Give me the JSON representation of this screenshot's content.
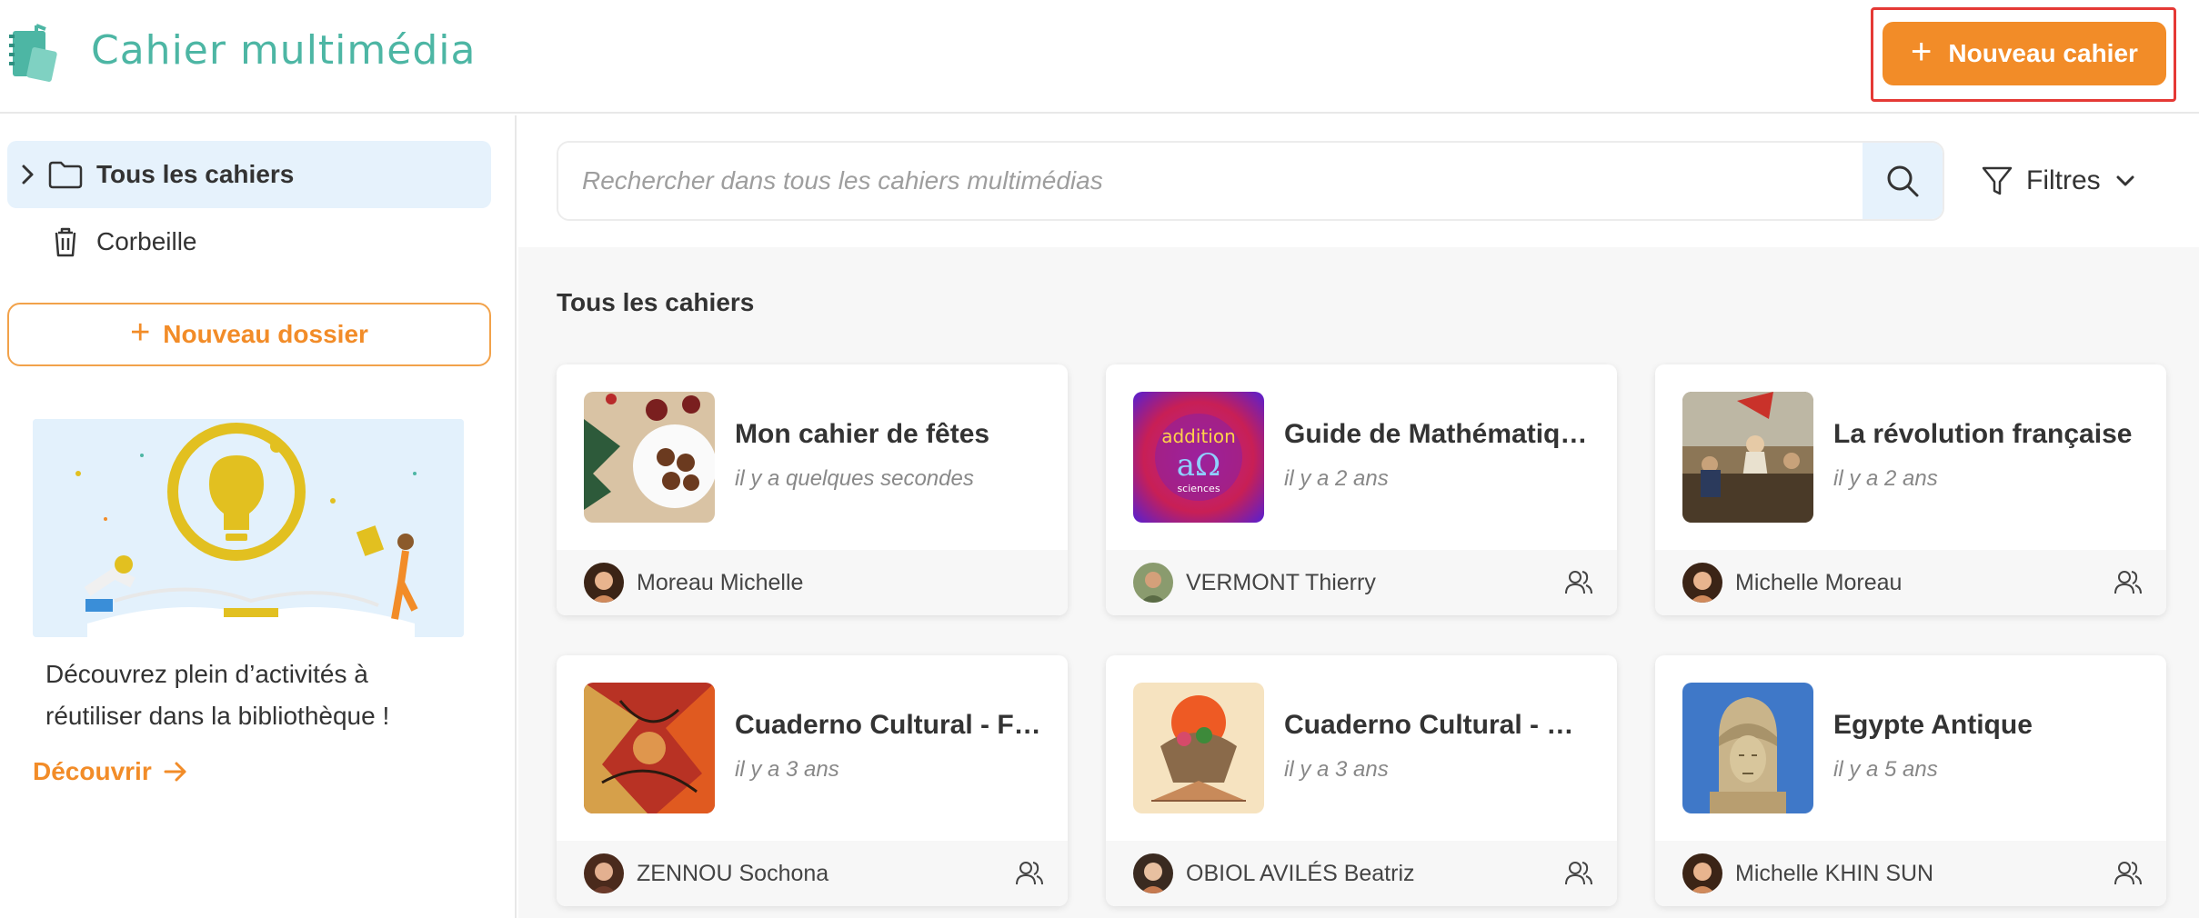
{
  "app": {
    "title": "Cahier multimédia",
    "new_cahier_label": "Nouveau cahier",
    "accent_color": "#f28c28",
    "brand_color": "#4db6a4"
  },
  "sidebar": {
    "items": [
      {
        "label": "Tous les cahiers",
        "icon": "folder-icon",
        "active": true
      },
      {
        "label": "Corbeille",
        "icon": "trash-icon",
        "active": false
      }
    ],
    "new_folder_label": "Nouveau dossier",
    "promo": {
      "text": "Découvrez plein d’activités à réutiliser dans la bibliothèque !",
      "link_label": "Découvrir"
    }
  },
  "search": {
    "placeholder": "Rechercher dans tous les cahiers multimédias"
  },
  "filters": {
    "label": "Filtres"
  },
  "main": {
    "section_title": "Tous les cahiers",
    "cards": [
      {
        "title": "Mon cahier de fêtes",
        "date": "il y a quelques secondes",
        "author": "Moreau Michelle",
        "shared": false
      },
      {
        "title": "Guide de Mathématique…",
        "date": "il y a 2 ans",
        "author": "VERMONT Thierry",
        "shared": true
      },
      {
        "title": "La révolution française",
        "date": "il y a 2 ans",
        "author": "Michelle Moreau",
        "shared": true
      },
      {
        "title": "Cuaderno Cultural - Fra…",
        "date": "il y a 3 ans",
        "author": "ZENNOU Sochona",
        "shared": true
      },
      {
        "title": "Cuaderno Cultural - Mex…",
        "date": "il y a 3 ans",
        "author": "OBIOL AVILÉS Beatriz",
        "shared": true
      },
      {
        "title": "Egypte Antique",
        "date": "il y a 5 ans",
        "author": "Michelle KHIN SUN",
        "shared": true
      }
    ]
  }
}
